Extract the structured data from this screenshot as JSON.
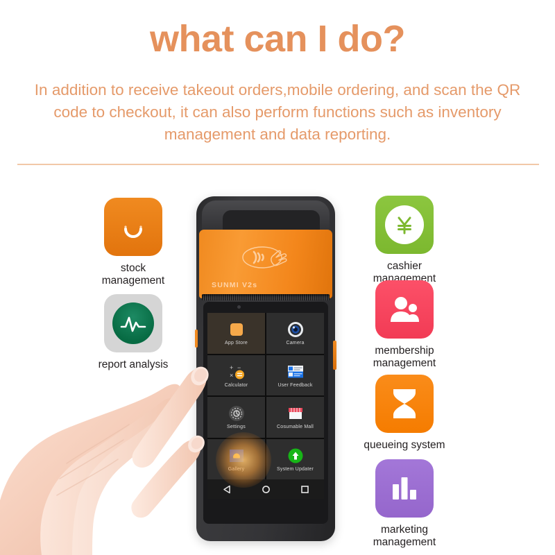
{
  "header": {
    "title": "what can I do?",
    "subtitle": "In addition to receive takeout orders,mobile ordering, and scan the QR code to checkout, it can also perform functions such as inventory management and data reporting.",
    "title_color": "#e5915c",
    "subtitle_color": "#e59a6a",
    "divider_color": "#f2c8a8"
  },
  "features": {
    "left": [
      {
        "id": "stock-management",
        "label": "stock\nmanagement",
        "label_line1": "stock",
        "label_line2": "management",
        "icon": "shopping-bag-icon",
        "color": "#ef8a1f"
      },
      {
        "id": "report-analysis",
        "label": "report analysis",
        "label_line1": "report analysis",
        "label_line2": "",
        "icon": "pulse-chart-icon",
        "color": "#0a7b4c"
      }
    ],
    "right": [
      {
        "id": "cashier-management",
        "label": "cashier management",
        "label_line1": "cashier",
        "label_line2": "management",
        "icon": "yen-coin-icon",
        "color": "#8cc63f"
      },
      {
        "id": "membership-management",
        "label": "membership management",
        "label_line1": "membership",
        "label_line2": "management",
        "icon": "people-icon",
        "color": "#f94a62"
      },
      {
        "id": "queueing-system",
        "label": "queueing system",
        "label_line1": "queueing system",
        "label_line2": "",
        "icon": "hourglass-icon",
        "color": "#f8861a"
      },
      {
        "id": "marketing-management",
        "label": "marketing management",
        "label_line1": "marketing",
        "label_line2": "management",
        "icon": "bar-chart-icon",
        "color": "#9c6fd4"
      }
    ]
  },
  "device": {
    "brand": "SUNMI V2s",
    "nfc_icon": "contactless-tap-icon",
    "apps": [
      {
        "name": "App Store",
        "icon": "app-store-icon",
        "highlighted": true
      },
      {
        "name": "Camera",
        "icon": "camera-icon",
        "highlighted": false
      },
      {
        "name": "Calculator",
        "icon": "calculator-icon",
        "highlighted": false
      },
      {
        "name": "User Feedback",
        "icon": "feedback-card-icon",
        "highlighted": false
      },
      {
        "name": "Settings",
        "icon": "settings-gear-icon",
        "highlighted": false
      },
      {
        "name": "Cosumable Mall",
        "icon": "shop-awning-icon",
        "highlighted": false
      },
      {
        "name": "Gallery",
        "icon": "gallery-photo-icon",
        "highlighted": false
      },
      {
        "name": "System Updater",
        "icon": "up-arrow-circle-icon",
        "highlighted": false
      }
    ],
    "navbar": [
      {
        "name": "back-button",
        "icon": "triangle-back-icon"
      },
      {
        "name": "home-button",
        "icon": "circle-home-icon"
      },
      {
        "name": "recents-button",
        "icon": "square-recents-icon"
      }
    ]
  }
}
